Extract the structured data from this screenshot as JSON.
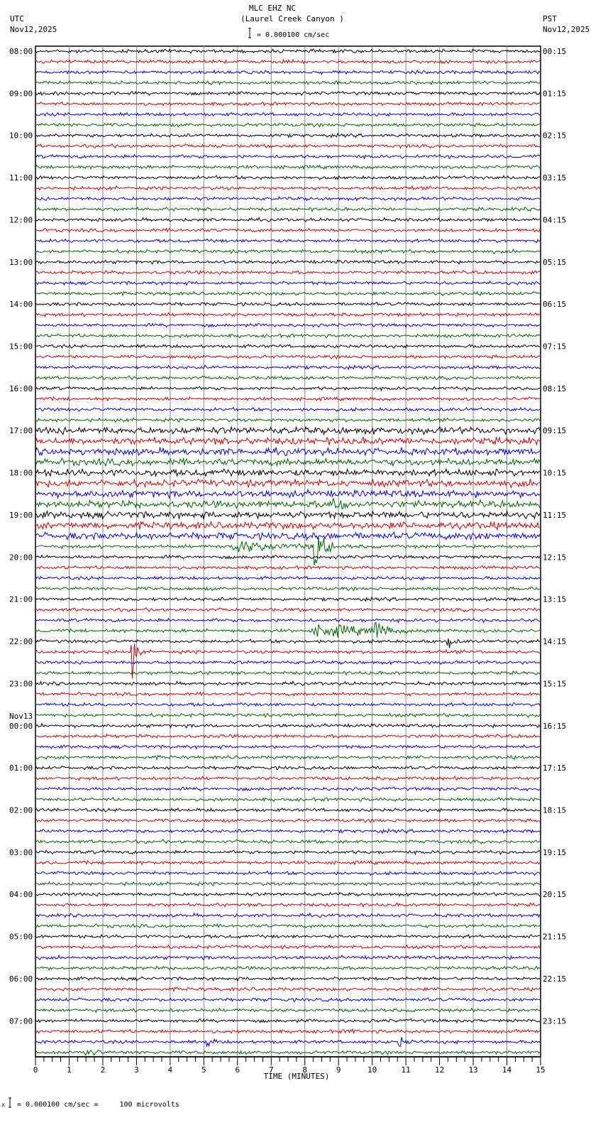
{
  "header": {
    "station": "MLC EHZ NC",
    "location": "(Laurel Creek Canyon )",
    "left_tz": "UTC",
    "left_date": "Nov12,2025",
    "right_tz": "PST",
    "right_date": "Nov12,2025",
    "scale": "= 0.000100 cm/sec"
  },
  "footer": {
    "scale": "= 0.000100 cm/sec =     100 microvolts",
    "mark": "x"
  },
  "chart_data": {
    "type": "line",
    "title": "MLC EHZ NC (Laurel Creek Canyon )",
    "xlabel": "TIME (MINUTES)",
    "xlim": [
      0,
      15
    ],
    "x_ticks": [
      "0",
      "1",
      "2",
      "3",
      "4",
      "5",
      "6",
      "7",
      "8",
      "9",
      "10",
      "11",
      "12",
      "13",
      "14",
      "15"
    ],
    "rows_per_hour": 4,
    "trace_colors": [
      "#000000",
      "#dd0000",
      "#0000ee",
      "#006600"
    ],
    "left_labels": [
      "08:00",
      "09:00",
      "10:00",
      "11:00",
      "12:00",
      "13:00",
      "14:00",
      "15:00",
      "16:00",
      "17:00",
      "18:00",
      "19:00",
      "20:00",
      "21:00",
      "22:00",
      "23:00",
      "00:00",
      "01:00",
      "02:00",
      "03:00",
      "04:00",
      "05:00",
      "06:00",
      "07:00"
    ],
    "date_change_label": "Nov13",
    "date_change_index": 16,
    "right_labels": [
      "00:15",
      "01:15",
      "02:15",
      "03:15",
      "04:15",
      "05:15",
      "06:15",
      "07:15",
      "08:15",
      "09:15",
      "10:15",
      "11:15",
      "12:15",
      "13:15",
      "14:15",
      "15:15",
      "16:15",
      "17:15",
      "18:15",
      "19:15",
      "20:15",
      "21:15",
      "22:15",
      "23:15"
    ],
    "noise_levels": {
      "default": 0.12,
      "noisy_rows": [
        36,
        37,
        38,
        39,
        40,
        41,
        42,
        43,
        44,
        45,
        46
      ],
      "noisy_level": 0.25
    },
    "events": [
      {
        "row": 43,
        "minute": 8.8,
        "duration": 0.5,
        "amplitude": 2.2
      },
      {
        "row": 46,
        "minute": 12.8,
        "duration": 0.3,
        "amplitude": 0.6
      },
      {
        "row": 47,
        "minute": 6.0,
        "duration": 3.6,
        "amplitude": 0.6
      },
      {
        "row": 47,
        "minute": 8.3,
        "duration": 0.6,
        "amplitude": 2.4
      },
      {
        "row": 55,
        "minute": 8.5,
        "duration": 3.5,
        "amplitude": 0.7
      },
      {
        "row": 55,
        "minute": 10.1,
        "duration": 0.5,
        "amplitude": 1.2
      },
      {
        "row": 56,
        "minute": 12.25,
        "duration": 0.3,
        "amplitude": 0.7
      },
      {
        "row": 57,
        "minute": 2.85,
        "duration": 0.3,
        "amplitude": 2.2
      },
      {
        "row": 80,
        "minute": 7.9,
        "duration": 0.15,
        "amplitude": 0.4
      },
      {
        "row": 93,
        "minute": 9.3,
        "duration": 0.2,
        "amplitude": 0.5
      },
      {
        "row": 94,
        "minute": 5.1,
        "duration": 0.3,
        "amplitude": 0.8
      },
      {
        "row": 94,
        "minute": 10.8,
        "duration": 0.4,
        "amplitude": 0.5
      },
      {
        "row": 95,
        "minute": 1.5,
        "duration": 0.6,
        "amplitude": 0.5
      }
    ]
  }
}
